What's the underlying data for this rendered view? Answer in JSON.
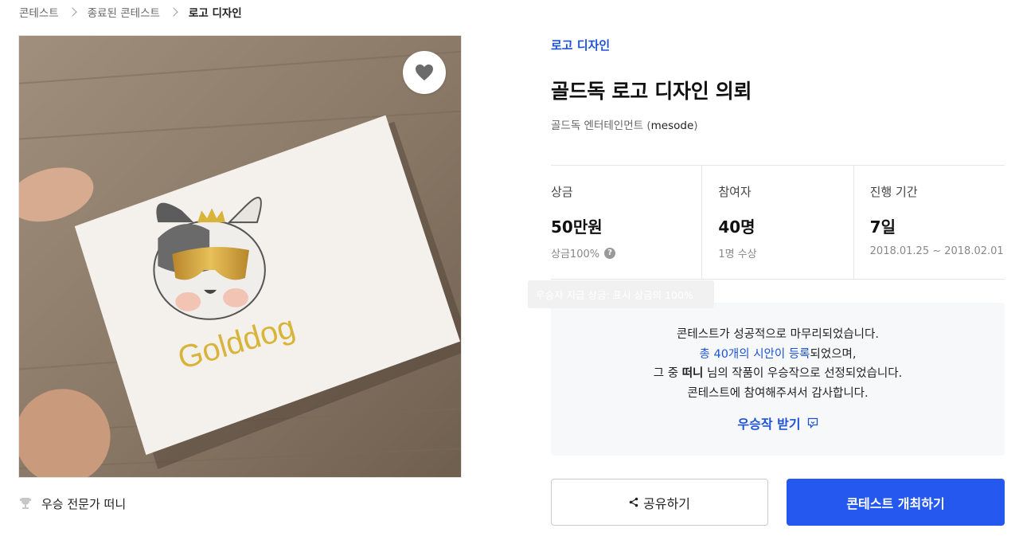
{
  "breadcrumb": {
    "items": [
      "콘테스트",
      "종료된 콘테스트"
    ],
    "current": "로고 디자인"
  },
  "image": {
    "alt_logo_text": "Golddog",
    "heart_icon": "heart-icon"
  },
  "winner_line": {
    "label": "우승 전문가 떠니",
    "icon": "trophy-icon"
  },
  "contest": {
    "category": "로고 디자인",
    "title": "골드독 로고 디자인 의뢰",
    "host_name": "골드독 엔터테인먼트 (",
    "host_id": "mesode",
    "host_close": ")"
  },
  "stats": [
    {
      "label": "상금",
      "value": "50만원",
      "sub": "상금100%",
      "help": "?"
    },
    {
      "label": "참여자",
      "value": "40명",
      "sub": "1명 수상"
    },
    {
      "label": "진행 기간",
      "value": "7일",
      "sub": "2018.01.25 ~ 2018.02.01"
    }
  ],
  "tooltip": "우승자 지급 상금: 표시 상금의 100%",
  "notice": {
    "line1": "콘테스트가 성공적으로 마무리되었습니다.",
    "line2_link": "총 40개의 시안이 등록",
    "line2_rest": "되었으며,",
    "line3_pre": "그 중 ",
    "line3_name": "떠니",
    "line3_post": " 님의 작품이 우승작으로 선정되었습니다.",
    "line4": "콘테스트에 참여해주셔서 감사합니다.",
    "get_label": "우승작 받기"
  },
  "buttons": {
    "share": "공유하기",
    "host": "콘테스트 개최하기"
  },
  "colors": {
    "accent": "#1e53d8",
    "primary_button": "#2458ef",
    "logo_gold": "#d9b43a"
  }
}
